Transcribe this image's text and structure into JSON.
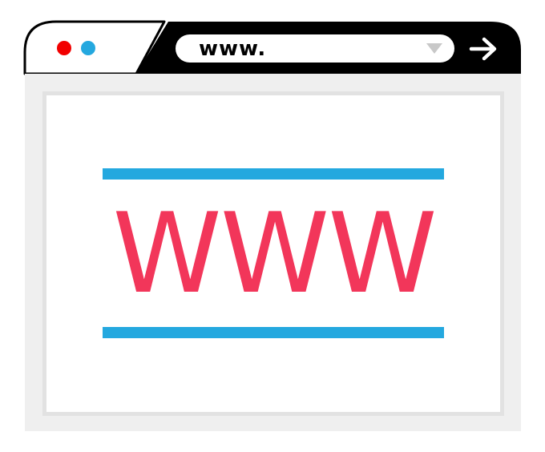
{
  "browser": {
    "window_controls": [
      {
        "name": "close-dot",
        "color": "#f20000"
      },
      {
        "name": "minimize-dot",
        "color": "#24a8df"
      }
    ],
    "address_bar": {
      "value": "www.",
      "dropdown_icon": "triangle-down-icon"
    },
    "go_icon": "arrow-right-icon"
  },
  "content": {
    "headline": "WWW",
    "headline_color": "#f2365a",
    "rule_color": "#24a8df"
  },
  "colors": {
    "toolbar": "#000000",
    "content_background": "#efefef",
    "frame_border": "#e2e2e2"
  }
}
